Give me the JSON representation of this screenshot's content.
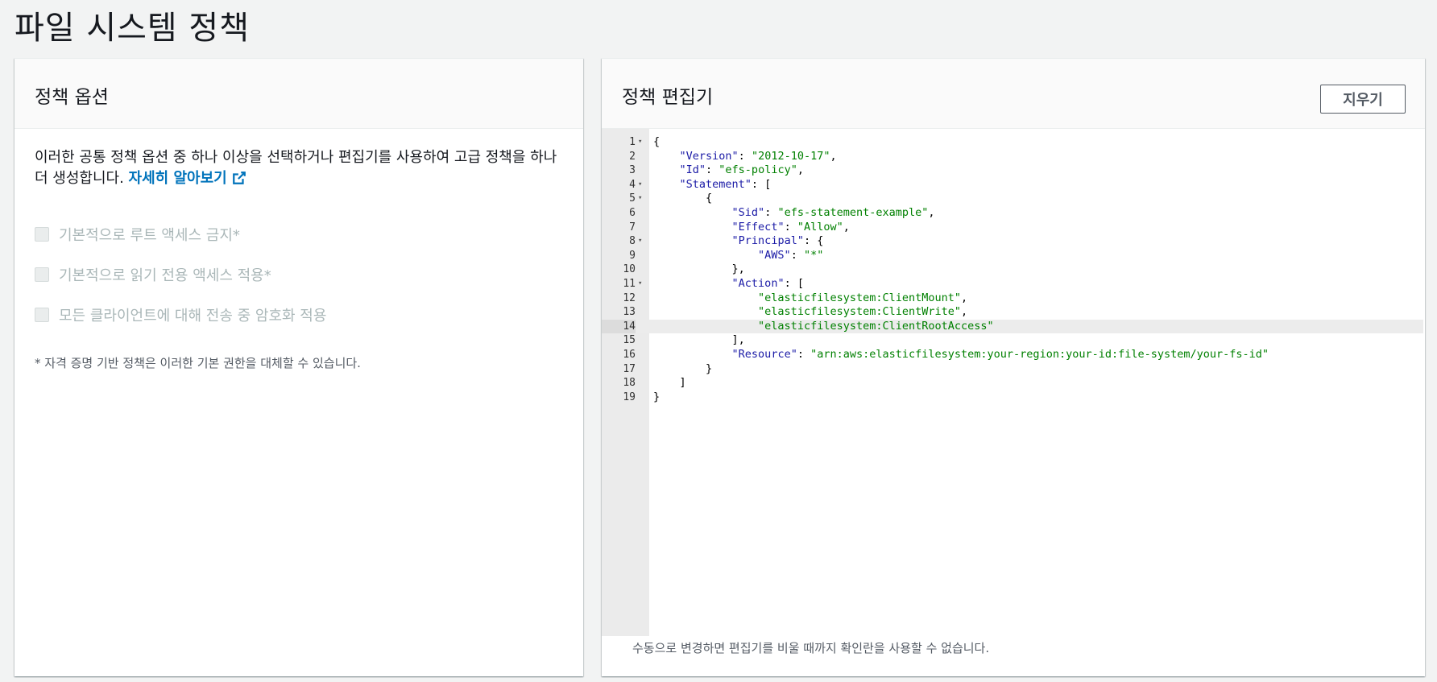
{
  "page": {
    "title": "파일 시스템 정책"
  },
  "options_panel": {
    "title": "정책 옵션",
    "description": "이러한 공통 정책 옵션 중 하나 이상을 선택하거나 편집기를 사용하여 고급 정책을 하나 더 생성합니다.",
    "learn_more": "자세히 알아보기",
    "options": [
      {
        "label": "기본적으로 루트 액세스 금지*",
        "checked": false,
        "disabled": true
      },
      {
        "label": "기본적으로 읽기 전용 액세스 적용*",
        "checked": false,
        "disabled": true
      },
      {
        "label": "모든 클라이언트에 대해 전송 중 암호화 적용",
        "checked": false,
        "disabled": true
      }
    ],
    "footnote": "* 자격 증명 기반 정책은 이러한 기본 권한을 대체할 수 있습니다."
  },
  "editor_panel": {
    "title": "정책 편집기",
    "clear_label": "지우기",
    "footer_note": "수동으로 변경하면 편집기를 비울 때까지 확인란을 사용할 수 없습니다.",
    "active_line": 14,
    "lines": [
      {
        "num": "1",
        "fold": true,
        "tokens": [
          {
            "t": "{",
            "c": "p"
          }
        ]
      },
      {
        "num": "2",
        "fold": false,
        "tokens": [
          {
            "t": "    ",
            "c": "p"
          },
          {
            "t": "\"Version\"",
            "c": "k"
          },
          {
            "t": ": ",
            "c": "p"
          },
          {
            "t": "\"2012-10-17\"",
            "c": "s"
          },
          {
            "t": ",",
            "c": "p"
          }
        ]
      },
      {
        "num": "3",
        "fold": false,
        "tokens": [
          {
            "t": "    ",
            "c": "p"
          },
          {
            "t": "\"Id\"",
            "c": "k"
          },
          {
            "t": ": ",
            "c": "p"
          },
          {
            "t": "\"efs-policy\"",
            "c": "s"
          },
          {
            "t": ",",
            "c": "p"
          }
        ]
      },
      {
        "num": "4",
        "fold": true,
        "tokens": [
          {
            "t": "    ",
            "c": "p"
          },
          {
            "t": "\"Statement\"",
            "c": "k"
          },
          {
            "t": ": [",
            "c": "p"
          }
        ]
      },
      {
        "num": "5",
        "fold": true,
        "tokens": [
          {
            "t": "        {",
            "c": "p"
          }
        ]
      },
      {
        "num": "6",
        "fold": false,
        "tokens": [
          {
            "t": "            ",
            "c": "p"
          },
          {
            "t": "\"Sid\"",
            "c": "k"
          },
          {
            "t": ": ",
            "c": "p"
          },
          {
            "t": "\"efs-statement-example\"",
            "c": "s"
          },
          {
            "t": ",",
            "c": "p"
          }
        ]
      },
      {
        "num": "7",
        "fold": false,
        "tokens": [
          {
            "t": "            ",
            "c": "p"
          },
          {
            "t": "\"Effect\"",
            "c": "k"
          },
          {
            "t": ": ",
            "c": "p"
          },
          {
            "t": "\"Allow\"",
            "c": "s"
          },
          {
            "t": ",",
            "c": "p"
          }
        ]
      },
      {
        "num": "8",
        "fold": true,
        "tokens": [
          {
            "t": "            ",
            "c": "p"
          },
          {
            "t": "\"Principal\"",
            "c": "k"
          },
          {
            "t": ": {",
            "c": "p"
          }
        ]
      },
      {
        "num": "9",
        "fold": false,
        "tokens": [
          {
            "t": "                ",
            "c": "p"
          },
          {
            "t": "\"AWS\"",
            "c": "k"
          },
          {
            "t": ": ",
            "c": "p"
          },
          {
            "t": "\"*\"",
            "c": "s"
          }
        ]
      },
      {
        "num": "10",
        "fold": false,
        "tokens": [
          {
            "t": "            },",
            "c": "p"
          }
        ]
      },
      {
        "num": "11",
        "fold": true,
        "tokens": [
          {
            "t": "            ",
            "c": "p"
          },
          {
            "t": "\"Action\"",
            "c": "k"
          },
          {
            "t": ": [",
            "c": "p"
          }
        ]
      },
      {
        "num": "12",
        "fold": false,
        "tokens": [
          {
            "t": "                ",
            "c": "p"
          },
          {
            "t": "\"elasticfilesystem:ClientMount\"",
            "c": "s"
          },
          {
            "t": ",",
            "c": "p"
          }
        ]
      },
      {
        "num": "13",
        "fold": false,
        "tokens": [
          {
            "t": "                ",
            "c": "p"
          },
          {
            "t": "\"elasticfilesystem:ClientWrite\"",
            "c": "s"
          },
          {
            "t": ",",
            "c": "p"
          }
        ]
      },
      {
        "num": "14",
        "fold": false,
        "tokens": [
          {
            "t": "                ",
            "c": "p"
          },
          {
            "t": "\"elasticfilesystem:ClientRootAccess\"",
            "c": "s"
          }
        ]
      },
      {
        "num": "15",
        "fold": false,
        "tokens": [
          {
            "t": "            ],",
            "c": "p"
          }
        ]
      },
      {
        "num": "16",
        "fold": false,
        "tokens": [
          {
            "t": "            ",
            "c": "p"
          },
          {
            "t": "\"Resource\"",
            "c": "k"
          },
          {
            "t": ": ",
            "c": "p"
          },
          {
            "t": "\"arn:aws:elasticfilesystem:your-region:your-id:file-system/your-fs-id\"",
            "c": "s"
          }
        ]
      },
      {
        "num": "17",
        "fold": false,
        "tokens": [
          {
            "t": "        }",
            "c": "p"
          }
        ]
      },
      {
        "num": "18",
        "fold": false,
        "tokens": [
          {
            "t": "    ]",
            "c": "p"
          }
        ]
      },
      {
        "num": "19",
        "fold": false,
        "tokens": [
          {
            "t": "}",
            "c": "p"
          }
        ]
      }
    ]
  },
  "colors": {
    "link": "#0073bb",
    "json_key": "#1a1aa6",
    "json_string": "#008000"
  }
}
